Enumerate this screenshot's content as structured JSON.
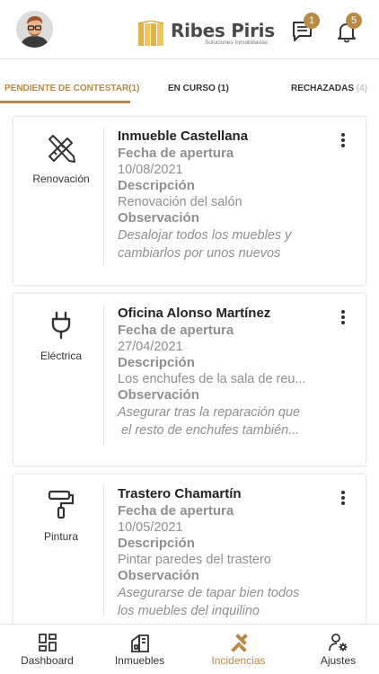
{
  "header": {
    "logo_name": "Ribes Piris",
    "logo_sub": "Soluciones Inmobiliarias",
    "messages_count": "1",
    "notifications_count": "5",
    "accent": "#b98a45"
  },
  "tabs": [
    {
      "label": "PENDIENTE DE CONTESTAR(1)"
    },
    {
      "label": "EN CURSO (1)"
    },
    {
      "label": "RECHAZADAS",
      "count": "(4)"
    }
  ],
  "cards": [
    {
      "category": "Renovación",
      "icon": "pencil-ruler-icon",
      "title": "Inmueble Castellana",
      "fecha_label": "Fecha de apertura",
      "fecha": "10/08/2021",
      "desc_label": "Descripción",
      "desc": "Renovación del salón",
      "obs_label": "Observación",
      "obs_line1": "Desalojar todos los muebles y",
      "obs_line2": "cambiarlos por unos nuevos"
    },
    {
      "category": "Eléctrica",
      "icon": "plug-icon",
      "title": "Oficina Alonso Martínez",
      "fecha_label": "Fecha de apertura",
      "fecha": "27/04/2021",
      "desc_label": "Descripción",
      "desc": "Los enchufes de la sala de reu...",
      "obs_label": "Observación",
      "obs_line1": "Asegurar tras la reparación que",
      "obs_line2": " el resto de enchufes también..."
    },
    {
      "category": "Pintura",
      "icon": "paint-roller-icon",
      "title": "Trastero Chamartín",
      "fecha_label": "Fecha de apertura",
      "fecha": "10/05/2021",
      "desc_label": "Descripción",
      "desc": "Pintar paredes del trastero",
      "obs_label": "Observación",
      "obs_line1": "Asegurarse de tapar bien todos",
      "obs_line2": "los muebles del inquilino"
    }
  ],
  "nav": [
    {
      "label": "Dashboard",
      "icon": "dashboard-icon"
    },
    {
      "label": "Inmuebles",
      "icon": "building-icon"
    },
    {
      "label": "Incidencias",
      "icon": "tools-icon",
      "active": true
    },
    {
      "label": "Ajustes",
      "icon": "user-settings-icon"
    }
  ]
}
